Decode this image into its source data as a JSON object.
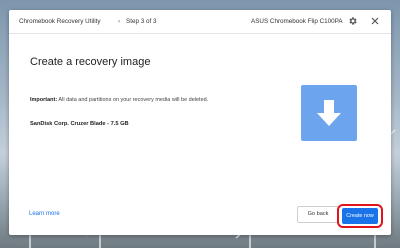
{
  "window": {
    "app_title": "Chromebook Recovery Utility",
    "separator": "›",
    "step": "Step 3 of 3",
    "device_model": "ASUS Chromebook Flip C100PA"
  },
  "main": {
    "heading": "Create a recovery image",
    "warning_prefix": "Important:",
    "warning_text": " All data and partitions on your recovery media will be deleted.",
    "selected_media": "SanDisk Corp. Cruzer Blade - 7.5 GB"
  },
  "footer": {
    "learn_more": "Learn more",
    "back_label": "Go back",
    "create_label": "Create now"
  },
  "colors": {
    "accent": "#1a73e8",
    "tile": "#6da4ee",
    "highlight": "#e0141c"
  },
  "icons": {
    "settings": "gear-icon",
    "close": "close-icon",
    "download": "download-arrow-icon"
  }
}
